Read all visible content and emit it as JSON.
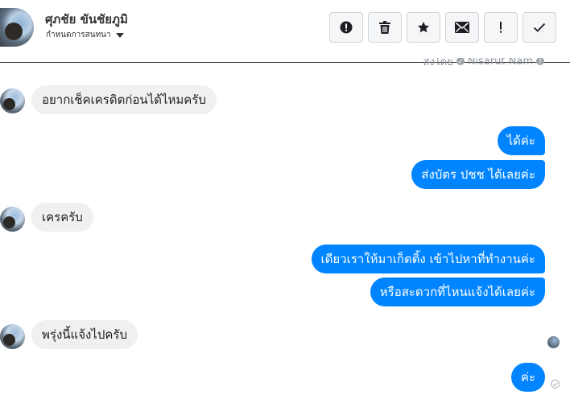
{
  "header": {
    "contact_name": "ศุภชัย ขันชัยภูมิ",
    "conversation_settings": "กำหนดการสนทนา"
  },
  "toolbar": {
    "buttons": [
      {
        "icon": "alert-circle-icon",
        "label": "Mark as spam"
      },
      {
        "icon": "trash-icon",
        "label": "Delete"
      },
      {
        "icon": "star-icon",
        "label": "Star"
      },
      {
        "icon": "envelope-icon",
        "label": "Mark as unread"
      },
      {
        "icon": "exclamation-icon",
        "label": "Follow up"
      },
      {
        "icon": "check-icon",
        "label": "Mark as done"
      }
    ]
  },
  "sent_by": {
    "prefix": "ส่งโดย",
    "name": "Nisarut Nam"
  },
  "messages": [
    {
      "side": "in",
      "text": "อยากเช็คเครดิตก่อนได้ไหมครับ"
    },
    {
      "side": "out",
      "text": "ได้ค่ะ"
    },
    {
      "side": "out",
      "text": "ส่งบัตร ปชช ได้เลยค่ะ"
    },
    {
      "side": "in",
      "text": "เครครับ"
    },
    {
      "side": "out",
      "text": "เดียวเราให้มาเก็ตติ้ง เข้าไปหาที่ทำงานค่ะ"
    },
    {
      "side": "out",
      "text": "หรือสะดวกที่ไหนแจ้งได้เลยค่ะ"
    },
    {
      "side": "in",
      "text": "พรุ่งนี้แจ้งไปครับ"
    },
    {
      "side": "out",
      "text": "ค่ะ"
    }
  ],
  "colors": {
    "outgoing_bubble": "#0084ff",
    "incoming_bubble": "#f0f0f0"
  }
}
